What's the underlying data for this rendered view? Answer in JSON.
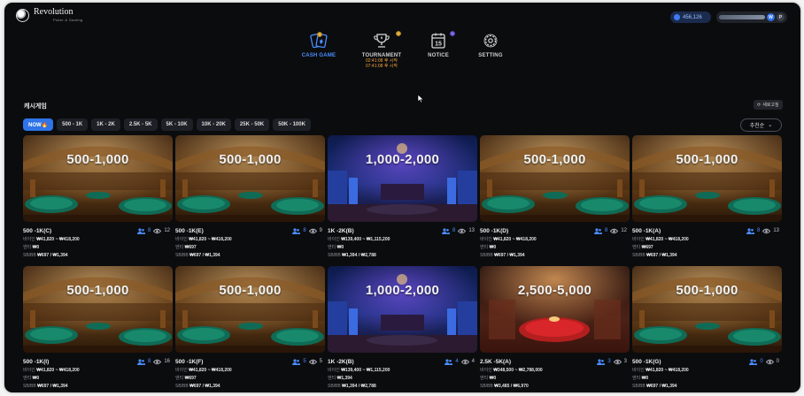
{
  "brand": {
    "name": "Revolution",
    "sub": "Poker & Gaming"
  },
  "header": {
    "balance": "456,126",
    "profile_w": "W",
    "profile_p": "P"
  },
  "nav": [
    {
      "label": "CASH GAME",
      "icon": "cards-icon",
      "active": true
    },
    {
      "label": "TOURNAMENT",
      "icon": "trophy-icon",
      "sub1": "02:41:08 후 시작",
      "sub2": "07:41:08 후 시작"
    },
    {
      "label": "NOTICE",
      "icon": "calendar-icon",
      "day": "15"
    },
    {
      "label": "SETTING",
      "icon": "gear-icon"
    }
  ],
  "section": {
    "title": "캐시게임",
    "refresh": "새로고침",
    "sort": "추천순"
  },
  "filters": [
    "NOW🔥",
    "500 - 1K",
    "1K - 2K",
    "2.5K - 5K",
    "5K - 10K",
    "10K - 20K",
    "25K - 50K",
    "50K - 100K"
  ],
  "info_labels": {
    "buyin": "바이인",
    "seat": "엔티",
    "blinds": "SB/BB"
  },
  "tables": [
    {
      "stakes": "500-1,000",
      "name": "500 -1K(C)",
      "players": "8",
      "watchers": "12",
      "buyin": "₩41,820 ~ ₩418,200",
      "ante": "₩0",
      "blinds": "₩697 / ₩1,394",
      "theme": "casino"
    },
    {
      "stakes": "500-1,000",
      "name": "500 -1K(E)",
      "players": "8",
      "watchers": "9",
      "buyin": "₩41,820 ~ ₩418,200",
      "ante": "₩697",
      "blinds": "₩697 / ₩1,394",
      "theme": "casino"
    },
    {
      "stakes": "1,000-2,000",
      "name": "1K -2K(B)",
      "players": "8",
      "watchers": "13",
      "buyin": "₩139,400 ~ ₩1,115,200",
      "ante": "₩0",
      "blinds": "₩1,394 / ₩2,788",
      "theme": "blue"
    },
    {
      "stakes": "500-1,000",
      "name": "500 -1K(D)",
      "players": "8",
      "watchers": "12",
      "buyin": "₩41,820 ~ ₩418,200",
      "ante": "₩0",
      "blinds": "₩697 / ₩1,394",
      "theme": "casino"
    },
    {
      "stakes": "500-1,000",
      "name": "500 -1K(A)",
      "players": "8",
      "watchers": "13",
      "buyin": "₩41,820 ~ ₩418,200",
      "ante": "₩697",
      "blinds": "₩697 / ₩1,394",
      "theme": "casino"
    },
    {
      "stakes": "500-1,000",
      "name": "500 -1K(I)",
      "players": "8",
      "watchers": "16",
      "buyin": "₩41,820 ~ ₩418,200",
      "ante": "₩0",
      "blinds": "₩697 / ₩1,394",
      "theme": "casino"
    },
    {
      "stakes": "500-1,000",
      "name": "500 -1K(F)",
      "players": "5",
      "watchers": "5",
      "buyin": "₩41,820 ~ ₩418,200",
      "ante": "₩697",
      "blinds": "₩697 / ₩1,394",
      "theme": "casino"
    },
    {
      "stakes": "1,000-2,000",
      "name": "1K -2K(B)",
      "players": "4",
      "watchers": "4",
      "buyin": "₩139,400 ~ ₩1,115,200",
      "ante": "₩1,394",
      "blinds": "₩1,394 / ₩2,788",
      "theme": "blue"
    },
    {
      "stakes": "2,500-5,000",
      "name": "2.5K -5K(A)",
      "players": "3",
      "watchers": "3",
      "buyin": "₩348,500 ~ ₩2,788,000",
      "ante": "₩0",
      "blinds": "₩3,485 / ₩6,970",
      "theme": "red"
    },
    {
      "stakes": "500-1,000",
      "name": "500 -1K(G)",
      "players": "0",
      "watchers": "0",
      "buyin": "₩41,820 ~ ₩418,200",
      "ante": "₩0",
      "blinds": "₩697 / ₩1,394",
      "theme": "casino"
    }
  ],
  "colors": {
    "accent": "#2e74e8",
    "background": "#0b0c0e",
    "tournament_time": "#f0a13a"
  }
}
